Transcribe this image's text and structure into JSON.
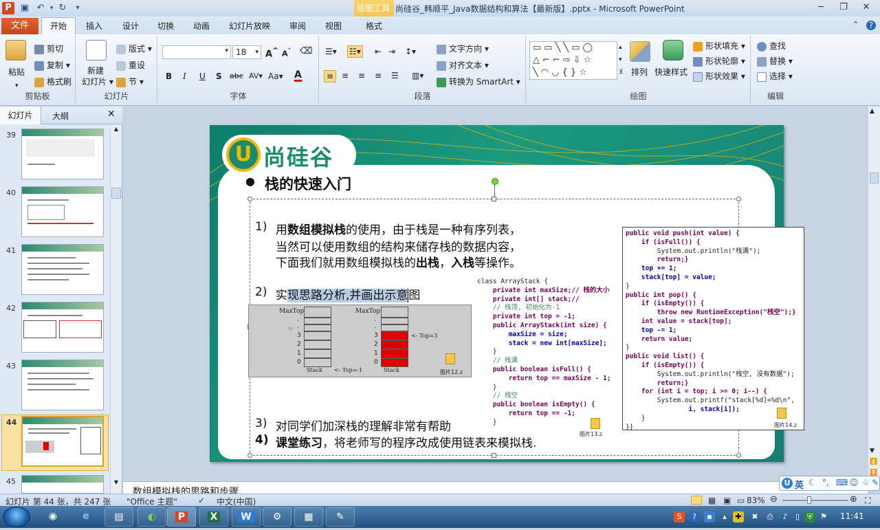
{
  "window": {
    "title": "尚硅谷_韩顺平_Java数据结构和算法【最新版】.pptx - Microsoft PowerPoint",
    "context_tool_group": "绘图工具",
    "context_tab": "格式"
  },
  "tabs": {
    "file": "文件",
    "items": [
      "开始",
      "插入",
      "设计",
      "切换",
      "动画",
      "幻灯片放映",
      "审阅",
      "视图"
    ],
    "active": "开始"
  },
  "ribbon": {
    "clipboard": {
      "label": "剪贴板",
      "paste": "粘贴",
      "cut": "剪切",
      "copy": "复制",
      "format_painter": "格式刷"
    },
    "slides": {
      "label": "幻灯片",
      "new_slide_1": "新建",
      "new_slide_2": "幻灯片",
      "layout": "版式",
      "reset": "重设",
      "section": "节"
    },
    "font": {
      "label": "字体",
      "font_name": "",
      "font_size": "18",
      "bold": "B",
      "italic": "I",
      "underline": "U",
      "shadow": "S",
      "strike": "abc",
      "spacing": "AV",
      "case": "Aa",
      "color": "A"
    },
    "paragraph": {
      "label": "段落",
      "text_direction": "文字方向",
      "align_text": "对齐文本",
      "smartart": "转换为 SmartArt"
    },
    "drawing": {
      "label": "绘图",
      "arrange": "排列",
      "quick_styles": "快速样式",
      "shape_fill": "形状填充",
      "shape_outline": "形状轮廓",
      "shape_effects": "形状效果"
    },
    "editing": {
      "label": "编辑",
      "find": "查找",
      "replace": "替换",
      "select": "选择"
    }
  },
  "left_panel": {
    "tab_slides": "幻灯片",
    "tab_outline": "大纲",
    "thumbnails": [
      "39",
      "40",
      "41",
      "42",
      "43",
      "44",
      "45"
    ],
    "selected": "44"
  },
  "slide": {
    "logo_text": "尚硅谷",
    "logo_u": "U",
    "heading": "栈的快速入门",
    "bullet": "●",
    "items": {
      "i1_num": "1)",
      "i1_line1_a": "用",
      "i1_line1_b": "数组模拟栈",
      "i1_line1_c": "的使用，由于栈是一种有序列表，",
      "i1_line2": "当然可以使用数组的结构来储存栈的数据内容，",
      "i1_line3_a": "下面我们就用数组模拟栈的",
      "i1_line3_b": "出栈",
      "i1_line3_c": "，",
      "i1_line3_d": "入栈",
      "i1_line3_e": "等操作。",
      "i2_num": "2)",
      "i2_a": "实",
      "i2_b": "现思路分析,并画出示意",
      "i2_c": "图",
      "i3_num": "3)",
      "i3": "对同学们加深栈的理解非常有帮助",
      "i4_num": "4)",
      "i4_bold": "课堂练习",
      "i4_rest": "，将老师写的程序改成使用链表来模拟栈."
    },
    "stack_diagram": {
      "left_label": "MaxTop",
      "right_label": "MaxTop",
      "left_stack": "Stack",
      "right_stack": "Stack",
      "left_top": "<- Top=-1",
      "right_top": "<- Top=3",
      "indices": [
        "3",
        "2",
        "1",
        "0"
      ],
      "dots": [
        ".",
        "."
      ],
      "image_label": "图片12.z"
    },
    "code_mid": {
      "image_label": "图片13.z",
      "lines": [
        "class ArrayStack {",
        "    private int maxSize;// 栈的大小",
        "    private int[] stack;//",
        "    // 栈顶, 初始化为-1",
        "    private int top = -1;",
        "    public ArrayStack(int size) {",
        "        maxSize = size;",
        "        stack = new int[maxSize];",
        "    }",
        "    // 栈满",
        "    public boolean isFull() {",
        "        return top == maxSize - 1;",
        "    }",
        "    // 栈空",
        "    public boolean isEmpty() {",
        "        return top == -1;",
        "    }"
      ]
    },
    "code_right": {
      "image_label": "图片14.z",
      "lines": [
        "public void push(int value) {",
        "    if (isFull()) {",
        "        System.out.println(\"栈满\");",
        "        return;}",
        "    top += 1;",
        "    stack[top] = value;",
        "}",
        "public int pop() {",
        "    if (isEmpty()) {",
        "        throw new RuntimeException(\"栈空\");}",
        "    int value = stack[top];",
        "    top -= 1;",
        "    return value;",
        "}",
        "public void list() {",
        "    if (isEmpty()) {",
        "        System.out.println(\"栈空, 没有数据\");",
        "        return;}",
        "    for (int i = top; i >= 0; i--) {",
        "        System.out.printf(\"stack[%d]=%d\\n\",",
        "                i, stack[i]);",
        "    }",
        "}}"
      ]
    }
  },
  "notes": {
    "text": "数组模拟栈的思路和步骤"
  },
  "status": {
    "slide_info": "幻灯片 第 44 张，共 247 张",
    "theme": "\"Office 主题\"",
    "language": "中文(中国)",
    "zoom": "83%"
  },
  "ime": {
    "label": "英"
  },
  "taskbar": {
    "clock": "11:41",
    "apps": [
      "Chrome",
      "IE",
      "Explorer",
      "Green",
      "PowerPoint",
      "Excel",
      "WPS",
      "Tool",
      "Calc",
      "Pen"
    ]
  }
}
